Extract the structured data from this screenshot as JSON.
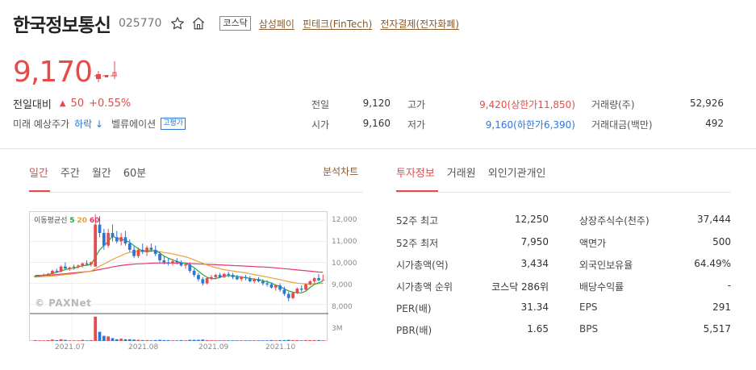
{
  "stock": {
    "name": "한국정보통신",
    "code": "025770",
    "market": "코스닥",
    "themes": [
      "삼성페이",
      "핀테크(FinTech)",
      "전자결제(전자화폐)"
    ],
    "price": "9,170",
    "change_label": "전일대비",
    "change_arrow": "▲",
    "change_value": "50",
    "change_pct": "+0.55%",
    "predict_label": "미래 예상주가",
    "predict_value": "하락 ↓",
    "valuation_label": "벨류에이션",
    "valuation_badge": "고평가"
  },
  "quote": {
    "prev_close_label": "전일",
    "prev_close": "9,120",
    "open_label": "시가",
    "open": "9,160",
    "high_label": "고가",
    "high": "9,420(상한가11,850)",
    "low_label": "저가",
    "low": "9,160(하한가6,390)",
    "volume_label": "거래량(주)",
    "volume": "52,926",
    "amount_label": "거래대금(백만)",
    "amount": "492"
  },
  "chart_tabs": [
    "일간",
    "주간",
    "월간",
    "60분"
  ],
  "chart_link": "분석차트",
  "info_tabs": [
    "투자정보",
    "거래원",
    "외인기관개인"
  ],
  "chart": {
    "ma_label": "이동평균선",
    "ma_periods": [
      "5",
      "20",
      "60"
    ],
    "watermark": "© PAXNet",
    "y_ticks": [
      "12,000",
      "11,000",
      "10,000",
      "9,000",
      "8,000"
    ],
    "volume_tick": "3M",
    "x_ticks": [
      "2021.07",
      "2021.08",
      "2021.09",
      "2021.10"
    ],
    "colors": {
      "up": "#e84a4a",
      "down": "#2d76d6",
      "ma5": "#2aa63a",
      "ma20": "#e8a13a",
      "ma60": "#e2386c"
    }
  },
  "chart_data": {
    "type": "candlestick",
    "y_range": [
      7600,
      12400
    ],
    "candles": [
      [
        9330,
        9380,
        9280,
        9350
      ],
      [
        9350,
        9400,
        9300,
        9380
      ],
      [
        9380,
        9460,
        9330,
        9420
      ],
      [
        9420,
        9500,
        9360,
        9450
      ],
      [
        9450,
        9650,
        9420,
        9600
      ],
      [
        9600,
        9700,
        9500,
        9560
      ],
      [
        9560,
        9850,
        9520,
        9800
      ],
      [
        9800,
        10000,
        9700,
        9700
      ],
      [
        9700,
        9800,
        9600,
        9750
      ],
      [
        9750,
        9900,
        9650,
        9800
      ],
      [
        9800,
        9900,
        9700,
        9850
      ],
      [
        9850,
        10000,
        9750,
        9950
      ],
      [
        9950,
        10100,
        9850,
        9900
      ],
      [
        9900,
        10050,
        9800,
        10000
      ],
      [
        9800,
        12300,
        9800,
        11800
      ],
      [
        11800,
        12200,
        11200,
        11400
      ],
      [
        11400,
        11600,
        10600,
        10800
      ],
      [
        10800,
        11600,
        10700,
        11400
      ],
      [
        11400,
        11800,
        11000,
        11200
      ],
      [
        11200,
        11500,
        10900,
        11000
      ],
      [
        11000,
        11400,
        10800,
        11200
      ],
      [
        11200,
        11500,
        10800,
        10900
      ],
      [
        10900,
        11100,
        10500,
        10600
      ],
      [
        10600,
        10800,
        10200,
        10300
      ],
      [
        10300,
        10700,
        10200,
        10600
      ],
      [
        10600,
        10900,
        10400,
        10500
      ],
      [
        10500,
        10800,
        10300,
        10700
      ],
      [
        10700,
        10900,
        10500,
        10600
      ],
      [
        10600,
        10800,
        10300,
        10400
      ],
      [
        10400,
        10500,
        10000,
        10100
      ],
      [
        10100,
        10300,
        9900,
        10000
      ],
      [
        10000,
        10200,
        9850,
        9950
      ],
      [
        9950,
        10150,
        9850,
        10050
      ],
      [
        10050,
        10200,
        9900,
        10000
      ],
      [
        10000,
        10100,
        9800,
        9850
      ],
      [
        9850,
        10000,
        9700,
        9900
      ],
      [
        9900,
        10000,
        9500,
        9600
      ],
      [
        9600,
        9700,
        9300,
        9400
      ],
      [
        9400,
        9500,
        9100,
        9200
      ],
      [
        9200,
        9300,
        8900,
        9000
      ],
      [
        9000,
        9300,
        8950,
        9250
      ],
      [
        9250,
        9400,
        9150,
        9300
      ],
      [
        9300,
        9450,
        9200,
        9400
      ],
      [
        9400,
        9500,
        9250,
        9300
      ],
      [
        9300,
        9500,
        9250,
        9450
      ],
      [
        9450,
        9550,
        9300,
        9400
      ],
      [
        9400,
        9500,
        9200,
        9300
      ],
      [
        9300,
        9400,
        9150,
        9200
      ],
      [
        9200,
        9350,
        9100,
        9300
      ],
      [
        9300,
        9400,
        9150,
        9250
      ],
      [
        9250,
        9350,
        9050,
        9100
      ],
      [
        9100,
        9250,
        9000,
        9200
      ],
      [
        9200,
        9300,
        9050,
        9100
      ],
      [
        9100,
        9200,
        8900,
        9000
      ],
      [
        9000,
        9150,
        8850,
        8950
      ],
      [
        8950,
        9050,
        8750,
        8800
      ],
      [
        8800,
        8950,
        8650,
        8900
      ],
      [
        8900,
        9000,
        8600,
        8700
      ],
      [
        8700,
        8850,
        8400,
        8500
      ],
      [
        8500,
        8600,
        8150,
        8300
      ],
      [
        8300,
        8600,
        8250,
        8550
      ],
      [
        8550,
        8800,
        8500,
        8750
      ],
      [
        8750,
        8900,
        8600,
        8700
      ],
      [
        8700,
        9000,
        8650,
        8950
      ],
      [
        8950,
        9150,
        8900,
        9100
      ],
      [
        9100,
        9300,
        9000,
        9250
      ],
      [
        9250,
        9450,
        9100,
        9150
      ],
      [
        9160,
        9420,
        9160,
        9170
      ]
    ],
    "ma5": [
      9330,
      9360,
      9390,
      9420,
      9480,
      9520,
      9600,
      9650,
      9700,
      9720,
      9780,
      9840,
      9860,
      9900,
      10250,
      10600,
      10800,
      11000,
      11250,
      11150,
      11100,
      11050,
      10950,
      10800,
      10650,
      10550,
      10500,
      10540,
      10560,
      10450,
      10300,
      10200,
      10120,
      10050,
      9990,
      9950,
      9870,
      9750,
      9580,
      9420,
      9290,
      9230,
      9230,
      9290,
      9350,
      9370,
      9360,
      9330,
      9300,
      9270,
      9240,
      9200,
      9180,
      9130,
      9080,
      9010,
      8920,
      8850,
      8740,
      8640,
      8580,
      8550,
      8550,
      8630,
      8810,
      8950,
      9030,
      9100
    ],
    "ma20": [
      9300,
      9310,
      9320,
      9330,
      9350,
      9370,
      9400,
      9420,
      9440,
      9460,
      9490,
      9520,
      9550,
      9580,
      9700,
      9820,
      9920,
      10030,
      10140,
      10230,
      10320,
      10420,
      10480,
      10500,
      10520,
      10540,
      10560,
      10560,
      10540,
      10510,
      10470,
      10440,
      10400,
      10360,
      10310,
      10260,
      10200,
      10120,
      10040,
      9960,
      9880,
      9810,
      9750,
      9700,
      9650,
      9620,
      9590,
      9560,
      9530,
      9500,
      9460,
      9420,
      9380,
      9340,
      9300,
      9260,
      9220,
      9180,
      9130,
      9080,
      9040,
      9010,
      8990,
      8980,
      8970,
      8980,
      8990,
      9000
    ],
    "ma60": [
      9380,
      9380,
      9380,
      9390,
      9400,
      9420,
      9440,
      9460,
      9480,
      9500,
      9520,
      9540,
      9560,
      9580,
      9620,
      9660,
      9700,
      9740,
      9780,
      9820,
      9850,
      9880,
      9900,
      9920,
      9930,
      9940,
      9950,
      9960,
      9970,
      9970,
      9970,
      9970,
      9970,
      9970,
      9960,
      9960,
      9950,
      9940,
      9930,
      9920,
      9910,
      9900,
      9890,
      9880,
      9870,
      9860,
      9850,
      9840,
      9830,
      9820,
      9810,
      9800,
      9790,
      9780,
      9770,
      9760,
      9740,
      9720,
      9700,
      9680,
      9660,
      9640,
      9620,
      9600,
      9580,
      9560,
      9540,
      9530
    ],
    "volume": [
      0.3,
      0.2,
      0.2,
      0.3,
      0.5,
      0.3,
      0.6,
      0.4,
      0.2,
      0.2,
      0.2,
      0.4,
      0.2,
      0.3,
      8.5,
      3.2,
      1.8,
      1.6,
      1.0,
      0.6,
      0.8,
      0.6,
      0.6,
      0.5,
      0.4,
      0.3,
      0.3,
      0.2,
      0.3,
      0.4,
      0.3,
      0.3,
      0.2,
      0.2,
      0.3,
      0.2,
      0.4,
      0.4,
      0.4,
      0.5,
      0.3,
      0.2,
      0.2,
      0.2,
      0.2,
      0.2,
      0.2,
      0.2,
      0.2,
      0.2,
      0.2,
      0.2,
      0.2,
      0.2,
      0.2,
      0.3,
      0.2,
      0.3,
      0.3,
      0.4,
      0.3,
      0.3,
      0.2,
      0.3,
      0.3,
      0.3,
      0.3,
      0.2
    ],
    "volume_range": [
      0,
      9
    ]
  },
  "invest_info": [
    {
      "label": "52주 최고",
      "value": "12,250",
      "label2": "상장주식수(천주)",
      "value2": "37,444"
    },
    {
      "label": "52주 최저",
      "value": "7,950",
      "label2": "액면가",
      "value2": "500"
    },
    {
      "label": "시가총액(억)",
      "value": "3,434",
      "label2": "외국인보유율",
      "value2": "64.49%"
    },
    {
      "label": "시가총액 순위",
      "value": "코스닥 286위",
      "label2": "배당수익률",
      "value2": "-"
    },
    {
      "label": "PER(배)",
      "value": "31.34",
      "label2": "EPS",
      "value2": "291"
    },
    {
      "label": "PBR(배)",
      "value": "1.65",
      "label2": "BPS",
      "value2": "5,517"
    }
  ]
}
